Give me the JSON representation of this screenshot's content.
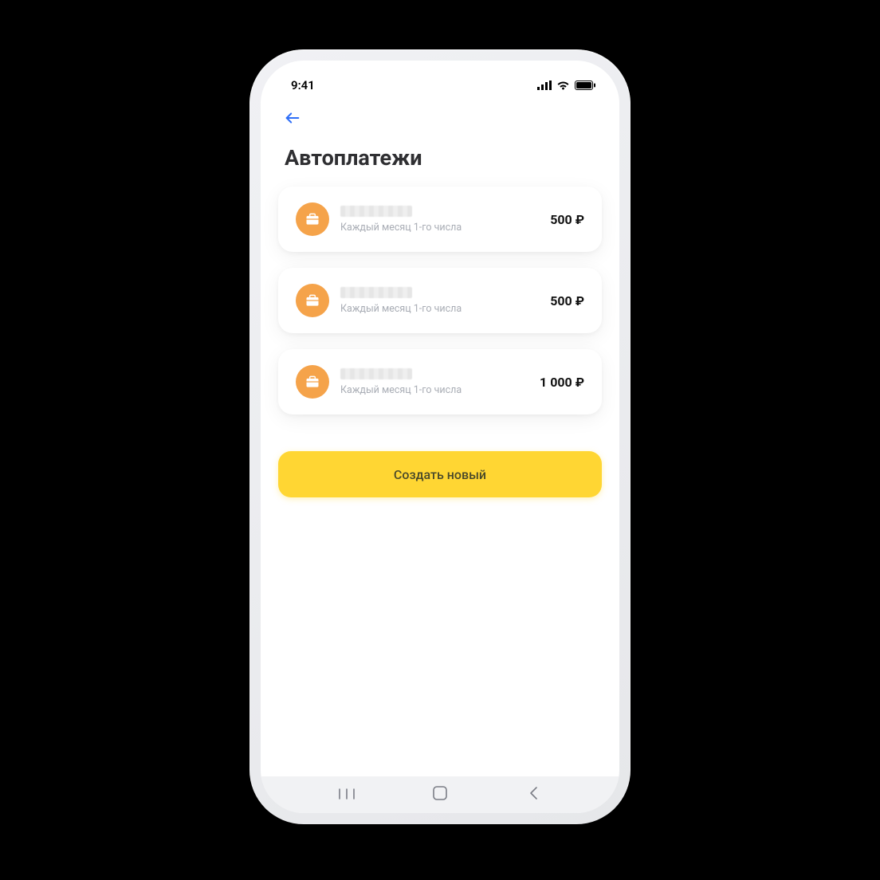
{
  "status": {
    "time": "9:41"
  },
  "header": {
    "title": "Автоплатежи"
  },
  "payments": [
    {
      "schedule": "Каждый месяц 1-го числа",
      "amount": "500 ₽"
    },
    {
      "schedule": "Каждый месяц 1-го числа",
      "amount": "500 ₽"
    },
    {
      "schedule": "Каждый месяц 1-го числа",
      "amount": "1 000 ₽"
    }
  ],
  "actions": {
    "create_new": "Создать новый"
  },
  "colors": {
    "accent": "#ffd633",
    "icon_bg": "#f5a34a",
    "back_arrow": "#2e6ef7"
  }
}
